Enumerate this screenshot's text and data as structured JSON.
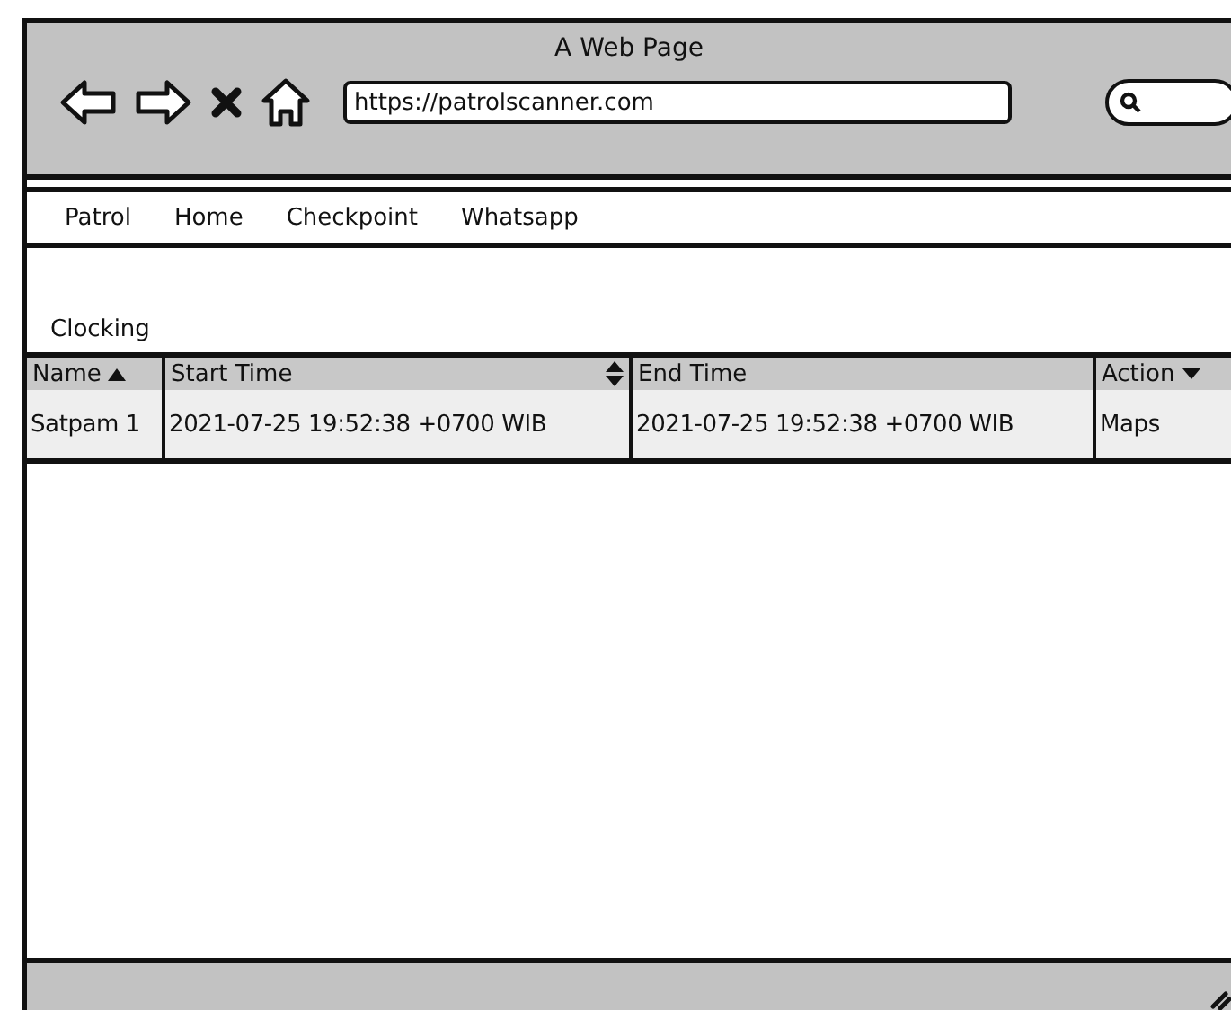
{
  "window": {
    "title": "A Web Page",
    "url": "https://patrolscanner.com"
  },
  "nav": [
    {
      "label": "Patrol"
    },
    {
      "label": "Home"
    },
    {
      "label": "Checkpoint"
    },
    {
      "label": "Whatsapp"
    }
  ],
  "heading": "Clocking",
  "table": {
    "columns": [
      {
        "label": "Name",
        "kind": "ascending"
      },
      {
        "label": "Start Time",
        "kind": "sortable"
      },
      {
        "label": "End Time",
        "kind": "plain"
      },
      {
        "label": "Action",
        "kind": "dropdown"
      }
    ],
    "rows": [
      [
        "Satpam 1",
        "2021-07-25 19:52:38 +0700 WIB",
        "2021-07-25 19:52:38 +0700 WIB",
        "Maps"
      ]
    ]
  }
}
